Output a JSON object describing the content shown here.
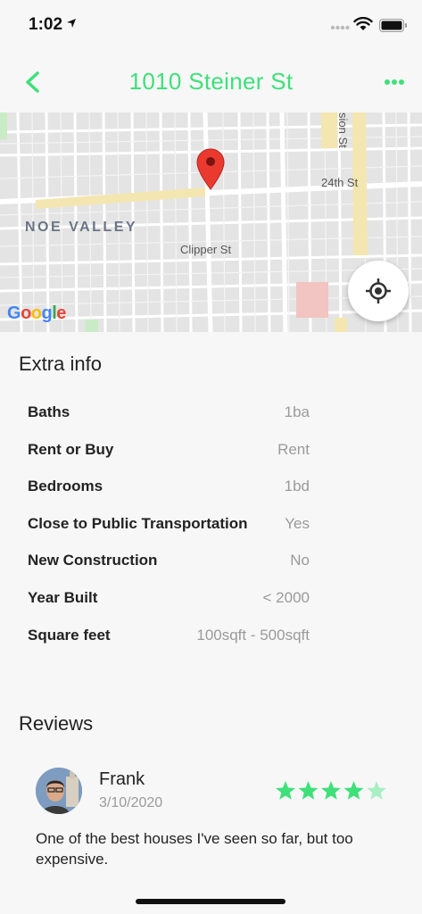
{
  "status_bar": {
    "time": "1:02"
  },
  "nav": {
    "title": "1010 Steiner St"
  },
  "map": {
    "neighborhood_label": "NOE VALLEY",
    "street_label_clipper": "Clipper St",
    "street_label_24th": "24th St",
    "street_label_sion": "sion St",
    "attribution": "Google"
  },
  "extra_info": {
    "title": "Extra info",
    "rows": [
      {
        "label": "Baths",
        "value": "1ba"
      },
      {
        "label": "Rent or Buy",
        "value": "Rent"
      },
      {
        "label": "Bedrooms",
        "value": "1bd"
      },
      {
        "label": "Close to Public Transportation",
        "value": "Yes"
      },
      {
        "label": "New Construction",
        "value": "No"
      },
      {
        "label": "Year Built",
        "value": "< 2000"
      },
      {
        "label": "Square feet",
        "value": "100sqft - 500sqft"
      }
    ]
  },
  "reviews": {
    "title": "Reviews",
    "items": [
      {
        "name": "Frank",
        "date": "3/10/2020",
        "rating": 4,
        "rating_max": 5,
        "text": "One of the best houses I've seen so far, but too expensive."
      }
    ]
  },
  "colors": {
    "accent": "#3ee07a",
    "star_empty": "#a8efc4"
  }
}
